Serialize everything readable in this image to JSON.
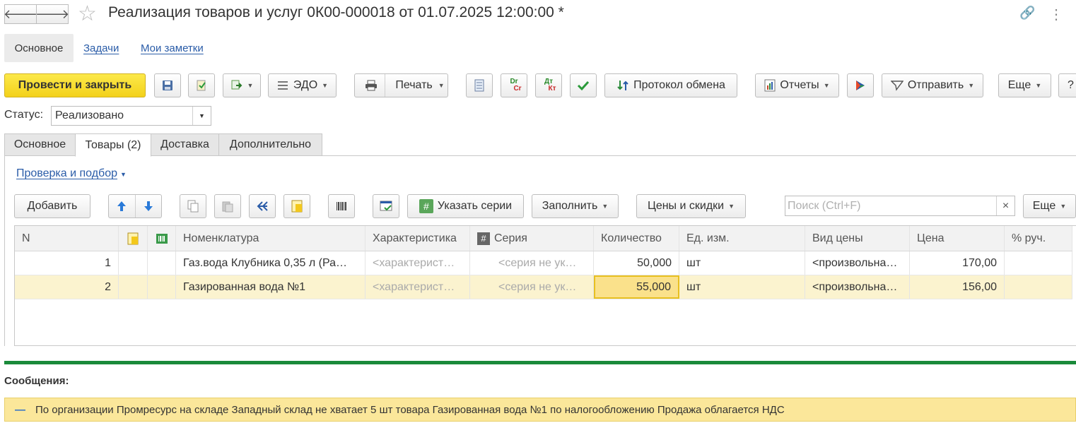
{
  "window": {
    "title": "Реализация товаров и услуг 0К00-000018 от 01.07.2025 12:00:00 *",
    "back_glyph": "🡐",
    "forward_glyph": "🡒",
    "star_glyph": "☆",
    "link_glyph": "🔗",
    "menu_glyph": "⋮"
  },
  "subtabs": {
    "main": "Основное",
    "tasks": "Задачи",
    "notes": "Мои заметки"
  },
  "toolbar": {
    "post_close": "Провести и закрыть",
    "edo": "ЭДО",
    "print": "Печать",
    "protocol": "Протокол обмена",
    "reports": "Отчеты",
    "send": "Отправить",
    "more": "Еще",
    "help": "?",
    "dr_cr_top": "Dr",
    "dr_cr_bottom": "Cr",
    "dt_kt_top": "Дт",
    "dt_kt_bottom": "Кт"
  },
  "status": {
    "label": "Статус:",
    "value": "Реализовано"
  },
  "tabs": [
    "Основное",
    "Товары (2)",
    "Доставка",
    "Дополнительно"
  ],
  "check_link": "Проверка и подбор",
  "goods_toolbar": {
    "add": "Добавить",
    "specify_series": "Указать серии",
    "fill": "Заполнить",
    "prices": "Цены и скидки",
    "more": "Еще",
    "search_placeholder": "Поиск (Ctrl+F)",
    "clear_glyph": "×"
  },
  "table": {
    "headers": {
      "n": "N",
      "nomenclature": "Номенклатура",
      "characteristic": "Характеристика",
      "series": "Серия",
      "series_icon": "#",
      "quantity": "Количество",
      "unit": "Ед. изм.",
      "price_type": "Вид цены",
      "price": "Цена",
      "manual_pct": "% руч."
    },
    "rows": [
      {
        "n": "1",
        "nomenclature": "Газ.вода Клубника 0,35 л (Ра…",
        "characteristic": "<характерист…",
        "series": "<серия не ук…",
        "quantity": "50,000",
        "unit": "шт",
        "price_type": "<произвольна…",
        "price": "170,00"
      },
      {
        "n": "2",
        "nomenclature": "Газированная вода №1",
        "characteristic": "<характерист…",
        "series": "<серия не ук…",
        "quantity": "55,000",
        "unit": "шт",
        "price_type": "<произвольна…",
        "price": "156,00"
      }
    ]
  },
  "messages": {
    "title": "Сообщения:",
    "items": [
      "По организации Промресурс на складе Западный склад не хватает 5 шт товара Газированная вода №1 по налогообложению Продажа облагается НДС"
    ],
    "dash_glyph": "—"
  },
  "colors": {
    "primary_button": "#f3d11b",
    "link": "#2a5ca8",
    "message_bg": "#fbe79a",
    "message_bar": "#1a8a3a",
    "selected_row": "#fbf3cf"
  }
}
